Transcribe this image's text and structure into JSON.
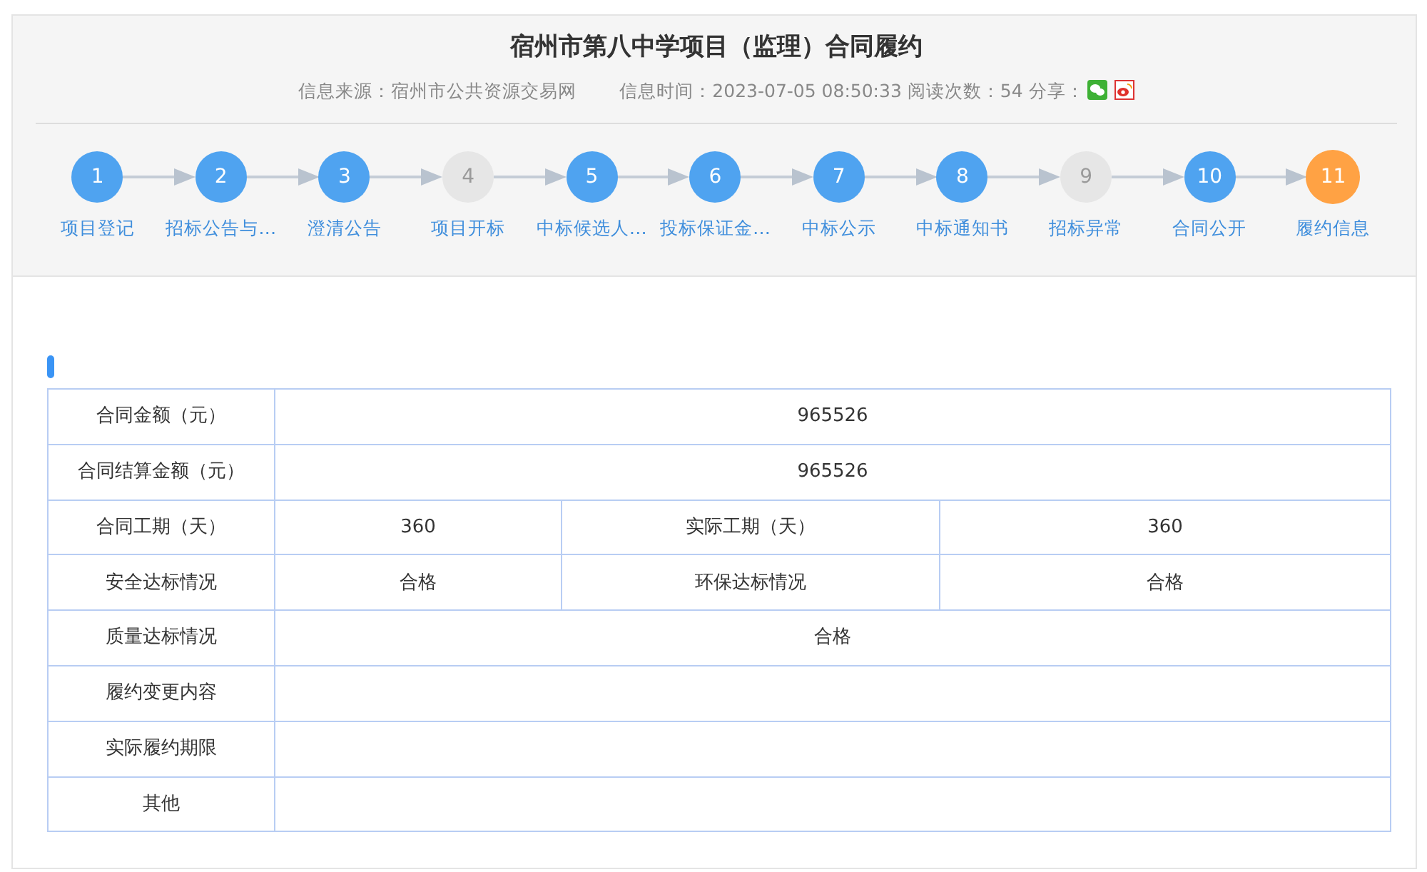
{
  "title": "宿州市第八中学项目（监理）合同履约",
  "meta": {
    "source": "信息来源：宿州市公共资源交易网",
    "time": "信息时间：2023-07-05 08:50:33",
    "reads": "阅读次数：54",
    "share": "分享："
  },
  "steps": [
    {
      "number": "1",
      "label": "项目登记",
      "disabled": false,
      "selected": false
    },
    {
      "number": "2",
      "label": "招标公告与…",
      "disabled": false,
      "selected": false
    },
    {
      "number": "3",
      "label": "澄清公告",
      "disabled": false,
      "selected": false
    },
    {
      "number": "4",
      "label": "项目开标",
      "disabled": true,
      "selected": false
    },
    {
      "number": "5",
      "label": "中标候选人…",
      "disabled": false,
      "selected": false
    },
    {
      "number": "6",
      "label": "投标保证金…",
      "disabled": false,
      "selected": false
    },
    {
      "number": "7",
      "label": "中标公示",
      "disabled": false,
      "selected": false
    },
    {
      "number": "8",
      "label": "中标通知书",
      "disabled": false,
      "selected": false
    },
    {
      "number": "9",
      "label": "招标异常",
      "disabled": true,
      "selected": false
    },
    {
      "number": "10",
      "label": "合同公开",
      "disabled": false,
      "selected": false
    },
    {
      "number": "11",
      "label": "履约信息",
      "disabled": false,
      "selected": true
    }
  ],
  "table": {
    "rows": [
      {
        "label": "合同金额（元）",
        "value": "965526"
      },
      {
        "label": "合同结算金额（元）",
        "value": "965526"
      },
      {
        "label": "合同工期（天）",
        "value": "360",
        "label_2": "实际工期（天）",
        "value_2": "360"
      },
      {
        "label": "安全达标情况",
        "value": "合格",
        "label_2": "环保达标情况",
        "value_2": "合格"
      },
      {
        "label": "质量达标情况",
        "value": "合格"
      },
      {
        "label": "履约变更内容"
      },
      {
        "label": "实际履约期限"
      },
      {
        "label": "其他"
      }
    ]
  }
}
